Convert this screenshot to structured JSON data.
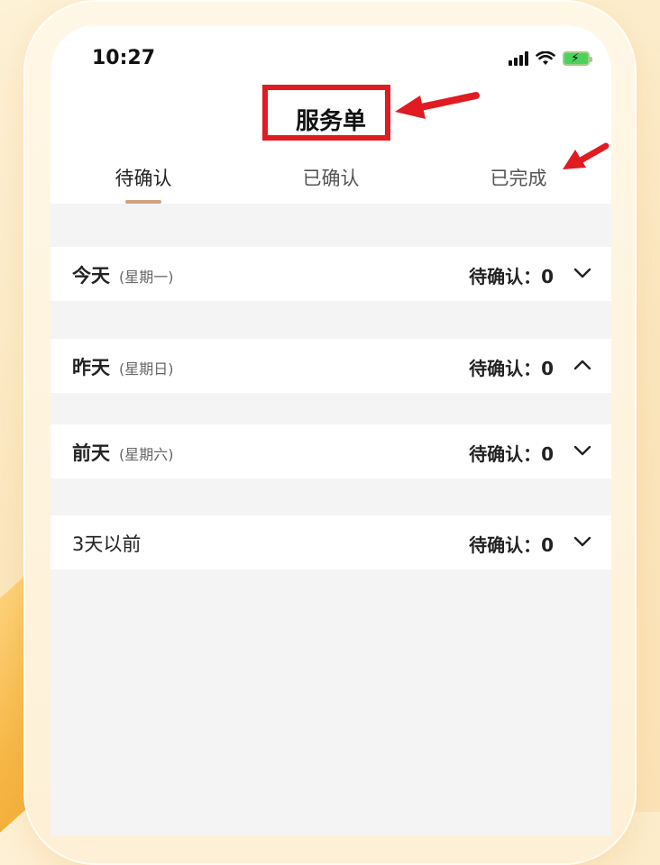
{
  "status_bar": {
    "time": "10:27"
  },
  "header": {
    "title": "服务单"
  },
  "tabs": [
    {
      "label": "待确认"
    },
    {
      "label": "已确认"
    },
    {
      "label": "已完成"
    }
  ],
  "sections": [
    {
      "title": "今天",
      "weekday": "(星期一)",
      "status": "待确认：0",
      "chevron": "chevron-down-icon"
    },
    {
      "title": "昨天",
      "weekday": "(星期日)",
      "status": "待确认：0",
      "chevron": "chevron-up-icon"
    },
    {
      "title": "前天",
      "weekday": "(星期六)",
      "status": "待确认：0",
      "chevron": "chevron-down-icon"
    },
    {
      "title": "3天以前",
      "weekday": "",
      "status": "待确认：0",
      "chevron": "chevron-down-icon"
    }
  ],
  "colors": {
    "annotation_red": "#e01b22",
    "tab_indicator": "#d2a27d",
    "battery_green": "#4bd25b"
  }
}
